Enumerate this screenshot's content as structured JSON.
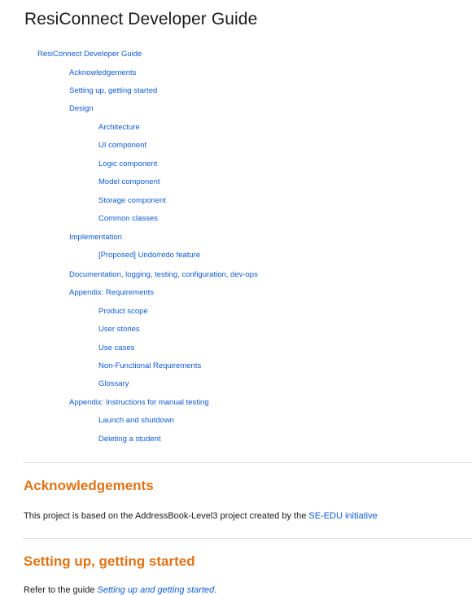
{
  "title": "ResiConnect Developer Guide",
  "toc": {
    "root": "ResiConnect Developer Guide",
    "acknowledgements": "Acknowledgements",
    "setting_up": "Setting up, getting started",
    "design": "Design",
    "architecture": "Architecture",
    "ui_component": "UI component",
    "logic_component": "Logic component",
    "model_component": "Model component",
    "storage_component": "Storage component",
    "common_classes": "Common classes",
    "implementation": "Implementation",
    "undo_redo": "[Proposed] Undo/redo feature",
    "documentation": "Documentation, logging, testing, configuration, dev-ops",
    "appendix_requirements": "Appendix: Requirements",
    "product_scope": "Product scope",
    "user_stories": "User stories",
    "use_cases": "Use cases",
    "nfr": "Non-Functional Requirements",
    "glossary": "Glossary",
    "appendix_manual_testing": "Appendix: Instructions for manual testing",
    "launch_shutdown": "Launch and shutdown",
    "deleting_student": "Deleting a student"
  },
  "sections": {
    "acknowledgements": {
      "heading": "Acknowledgements",
      "text_before": "This project is based on the AddressBook-Level3 project created by the ",
      "link": "SE-EDU initiative"
    },
    "setting_up": {
      "heading": "Setting up, getting started",
      "text_before": "Refer to the guide ",
      "link": "Setting up and getting started",
      "text_after": "."
    }
  }
}
